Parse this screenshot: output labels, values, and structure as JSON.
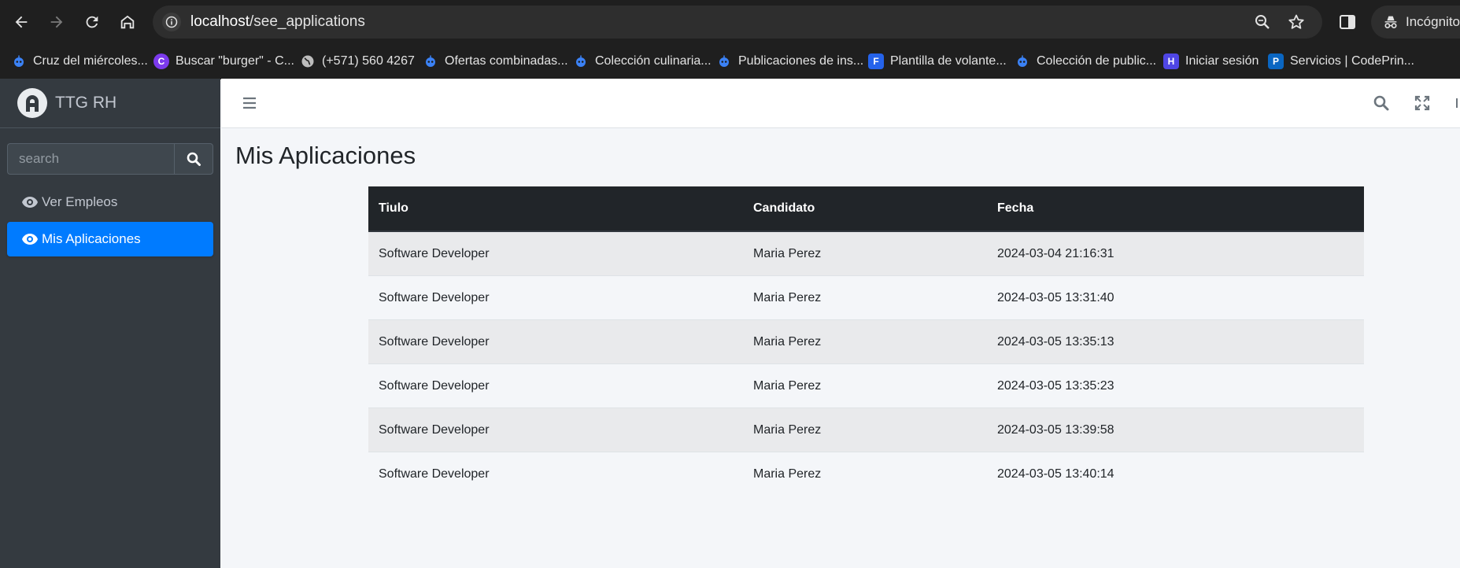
{
  "browser": {
    "url_host": "localhost",
    "url_path": "/see_applications",
    "incognito_label": "Incógnito",
    "bookmarks": [
      {
        "label": "Cruz del miércoles..."
      },
      {
        "label": "Buscar \"burger\" - C..."
      },
      {
        "label": "(+571) 560 4267"
      },
      {
        "label": "Ofertas combinadas..."
      },
      {
        "label": "Colección culinaria..."
      },
      {
        "label": "Publicaciones de ins..."
      },
      {
        "label": "Plantilla de volante..."
      },
      {
        "label": "Colección de public..."
      },
      {
        "label": "Iniciar sesión"
      },
      {
        "label": "Servicios | CodePrin..."
      }
    ]
  },
  "sidebar": {
    "brand": "TTG RH",
    "search_placeholder": "search",
    "items": [
      {
        "label": "Ver Empleos",
        "active": false
      },
      {
        "label": "Mis Aplicaciones",
        "active": true
      }
    ]
  },
  "main": {
    "title": "Mis Aplicaciones",
    "table": {
      "headers": [
        "Tiulo",
        "Candidato",
        "Fecha"
      ],
      "rows": [
        [
          "Software Developer",
          "Maria Perez",
          "2024-03-04 21:16:31"
        ],
        [
          "Software Developer",
          "Maria Perez",
          "2024-03-05 13:31:40"
        ],
        [
          "Software Developer",
          "Maria Perez",
          "2024-03-05 13:35:13"
        ],
        [
          "Software Developer",
          "Maria Perez",
          "2024-03-05 13:35:23"
        ],
        [
          "Software Developer",
          "Maria Perez",
          "2024-03-05 13:39:58"
        ],
        [
          "Software Developer",
          "Maria Perez",
          "2024-03-05 13:40:14"
        ]
      ]
    }
  },
  "colors": {
    "active_nav": "#007bff",
    "sidebar_bg": "#343a40",
    "table_header_bg": "#212529"
  }
}
